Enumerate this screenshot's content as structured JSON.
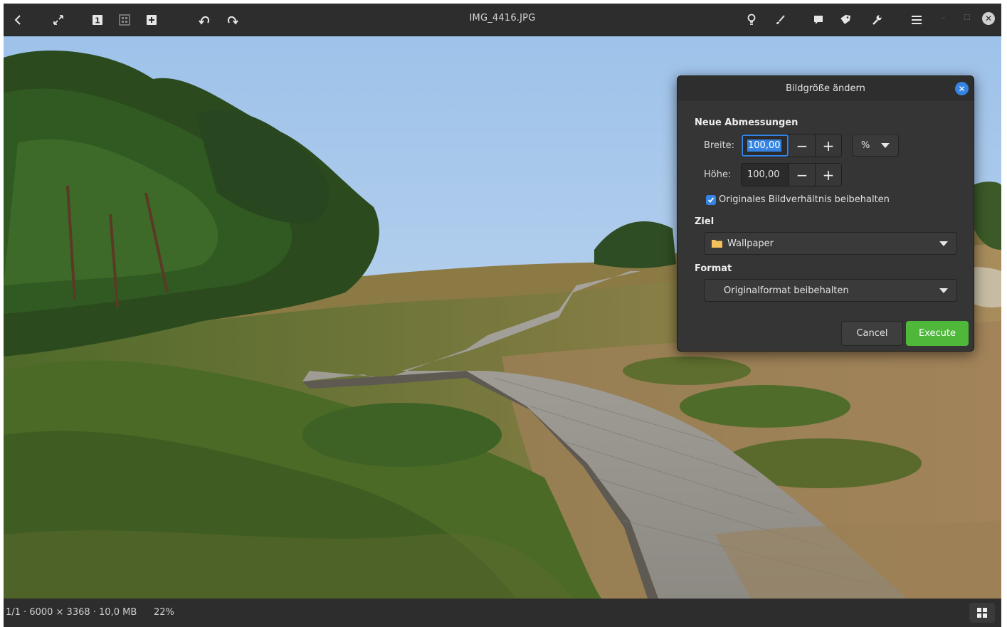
{
  "header": {
    "title": "IMG_4416.JPG"
  },
  "dialog": {
    "title": "Bildgröße ändern",
    "section_dimensions": "Neue Abmessungen",
    "width_label": "Breite:",
    "width_value": "100,00",
    "height_label": "Höhe:",
    "height_value": "100,00",
    "unit": "%",
    "keep_ratio_label": "Originales Bildverhältnis beibehalten",
    "keep_ratio_checked": true,
    "section_target": "Ziel",
    "target_value": "Wallpaper",
    "section_format": "Format",
    "format_value": "Originalformat beibehalten",
    "cancel_label": "Cancel",
    "execute_label": "Execute"
  },
  "status": {
    "info": "1/1 · 6000 × 3368 · 10,0 MB",
    "zoom": "22%"
  },
  "colors": {
    "accent": "#3584e4",
    "execute": "#4fb83b",
    "folder": "#f5c15a"
  }
}
